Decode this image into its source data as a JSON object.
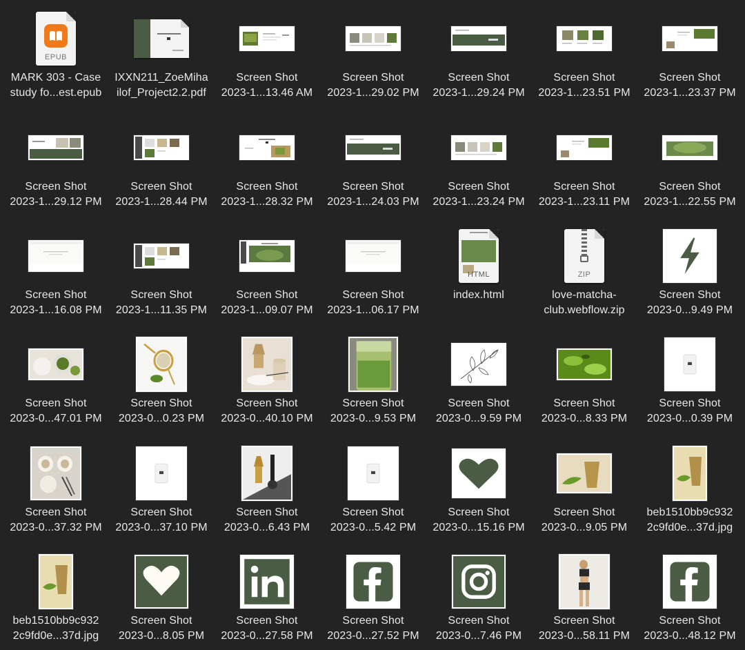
{
  "files": [
    {
      "line1": "MARK 303 - Case",
      "line2": "study fo...est.epub",
      "kind": "epub",
      "tag": "EPUB"
    },
    {
      "line1": "IXXN211_ZoeMiha",
      "line2": "ilof_Project2.2.pdf",
      "kind": "pdf"
    },
    {
      "line1": "Screen Shot",
      "line2": "2023-1...13.46 AM",
      "kind": "web-a"
    },
    {
      "line1": "Screen Shot",
      "line2": "2023-1...29.02 PM",
      "kind": "web-b"
    },
    {
      "line1": "Screen Shot",
      "line2": "2023-1...29.24 PM",
      "kind": "web-c"
    },
    {
      "line1": "Screen Shot",
      "line2": "2023-1...23.51 PM",
      "kind": "web-d"
    },
    {
      "line1": "Screen Shot",
      "line2": "2023-1...23.37 PM",
      "kind": "web-e"
    },
    {
      "line1": "Screen Shot",
      "line2": "2023-1...29.12 PM",
      "kind": "web-f"
    },
    {
      "line1": "Screen Shot",
      "line2": "2023-1...28.44 PM",
      "kind": "web-g"
    },
    {
      "line1": "Screen Shot",
      "line2": "2023-1...28.32 PM",
      "kind": "web-h"
    },
    {
      "line1": "Screen Shot",
      "line2": "2023-1...24.03 PM",
      "kind": "web-c"
    },
    {
      "line1": "Screen Shot",
      "line2": "2023-1...23.24 PM",
      "kind": "web-b"
    },
    {
      "line1": "Screen Shot",
      "line2": "2023-1...23.11 PM",
      "kind": "web-e"
    },
    {
      "line1": "Screen Shot",
      "line2": "2023-1...22.55 PM",
      "kind": "web-i"
    },
    {
      "line1": "Screen Shot",
      "line2": "2023-1...16.08 PM",
      "kind": "web-j"
    },
    {
      "line1": "Screen Shot",
      "line2": "2023-1...11.35 PM",
      "kind": "web-g"
    },
    {
      "line1": "Screen Shot",
      "line2": "2023-1...09.07 PM",
      "kind": "web-k"
    },
    {
      "line1": "Screen Shot",
      "line2": "2023-1...06.17 PM",
      "kind": "web-j"
    },
    {
      "line1": "index.html",
      "line2": "",
      "kind": "html",
      "tag": "HTML"
    },
    {
      "line1": "love-matcha-",
      "line2": "club.webflow.zip",
      "kind": "zip",
      "tag": "ZIP"
    },
    {
      "line1": "Screen Shot",
      "line2": "2023-0...9.49 PM",
      "kind": "bolt"
    },
    {
      "line1": "Screen Shot",
      "line2": "2023-0...47.01 PM",
      "kind": "bowl"
    },
    {
      "line1": "Screen Shot",
      "line2": "2023-0...0.23 PM",
      "kind": "strainer"
    },
    {
      "line1": "Screen Shot",
      "line2": "2023-0...40.10 PM",
      "kind": "whisk"
    },
    {
      "line1": "Screen Shot",
      "line2": "2023-0...9.53 PM",
      "kind": "drink"
    },
    {
      "line1": "Screen Shot",
      "line2": "2023-0...9.59 PM",
      "kind": "leaves"
    },
    {
      "line1": "Screen Shot",
      "line2": "2023-0...8.33 PM",
      "kind": "green"
    },
    {
      "line1": "Screen Shot",
      "line2": "2023-0...0.39 PM",
      "kind": "pouch"
    },
    {
      "line1": "Screen Shot",
      "line2": "2023-0...37.32 PM",
      "kind": "cups"
    },
    {
      "line1": "Screen Shot",
      "line2": "2023-0...37.10 PM",
      "kind": "pouch2"
    },
    {
      "line1": "Screen Shot",
      "line2": "2023-0...6.43 PM",
      "kind": "frother"
    },
    {
      "line1": "Screen Shot",
      "line2": "2023-0...5.42 PM",
      "kind": "pouch3"
    },
    {
      "line1": "Screen Shot",
      "line2": "2023-0...15.16 PM",
      "kind": "heart-dark"
    },
    {
      "line1": "Screen Shot",
      "line2": "2023-0...9.05 PM",
      "kind": "whisk2"
    },
    {
      "line1": "beb1510bb9c932",
      "line2": "2c9fd0e...37d.jpg",
      "kind": "tallwhisk"
    },
    {
      "line1": "beb1510bb9c932",
      "line2": "2c9fd0e...37d.jpg",
      "kind": "tallwhisk"
    },
    {
      "line1": "Screen Shot",
      "line2": "2023-0...8.05 PM",
      "kind": "heart-light"
    },
    {
      "line1": "Screen Shot",
      "line2": "2023-0...27.58 PM",
      "kind": "linkedin"
    },
    {
      "line1": "Screen Shot",
      "line2": "2023-0...27.52 PM",
      "kind": "facebook"
    },
    {
      "line1": "Screen Shot",
      "line2": "2023-0...7.46 PM",
      "kind": "instagram"
    },
    {
      "line1": "Screen Shot",
      "line2": "2023-0...58.11 PM",
      "kind": "person"
    },
    {
      "line1": "Screen Shot",
      "line2": "2023-0...48.12 PM",
      "kind": "facebook2"
    }
  ],
  "colors": {
    "background": "#232323",
    "label": "#e8e8e8",
    "matcha_dark": "#4a5d44",
    "matcha": "#5a7a3a",
    "epub_orange": "#f07a1a"
  }
}
